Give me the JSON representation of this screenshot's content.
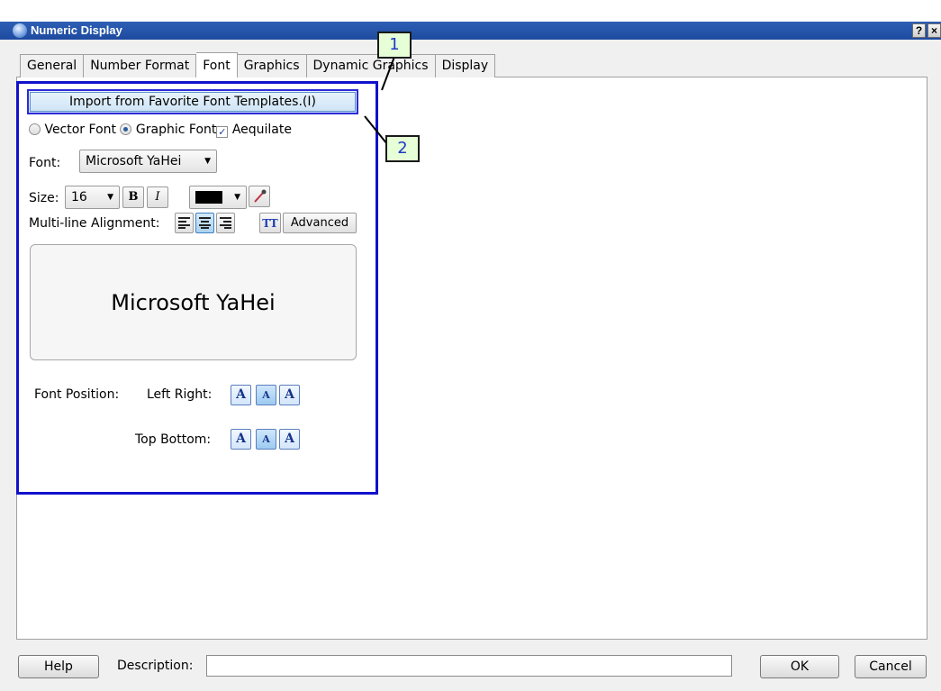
{
  "window": {
    "title": "Numeric Display",
    "help_glyph": "?",
    "close_glyph": "×"
  },
  "tabs": [
    {
      "label": "General",
      "active": false
    },
    {
      "label": "Number Format",
      "active": false
    },
    {
      "label": "Font",
      "active": true
    },
    {
      "label": "Graphics",
      "active": false
    },
    {
      "label": "Dynamic Graphics",
      "active": false
    },
    {
      "label": "Display",
      "active": false
    }
  ],
  "callouts": {
    "one": "1",
    "two": "2"
  },
  "font_tab": {
    "import_button": "Import from Favorite Font Templates.(I)",
    "vector_font_label": "Vector Font",
    "vector_font_selected": false,
    "graphic_font_label": "Graphic Font",
    "graphic_font_selected": true,
    "aequilate_label": "Aequilate",
    "aequilate_checked": true,
    "font_label": "Font:",
    "font_value": "Microsoft YaHei",
    "size_label": "Size:",
    "size_value": "16",
    "bold_glyph": "B",
    "italic_glyph": "I",
    "text_color": "#000000",
    "multiline_label": "Multi-line Alignment:",
    "alignment_selected": "center",
    "tt_glyph": "TT",
    "advanced_button": "Advanced",
    "preview_text": "Microsoft YaHei",
    "font_position_label": "Font Position:",
    "left_right_label": "Left Right:",
    "top_bottom_label": "Top Bottom:",
    "horizontal_selected": "center",
    "vertical_selected": "center",
    "position_glyph": "A"
  },
  "footer": {
    "help_button": "Help",
    "description_label": "Description:",
    "description_value": "",
    "ok_button": "OK",
    "cancel_button": "Cancel"
  },
  "colors": {
    "titlebar": "#1e4aa0",
    "highlight_box": "#1111cc",
    "callout_fill": "#e6ffd6",
    "callout_text": "#1e38c8"
  }
}
